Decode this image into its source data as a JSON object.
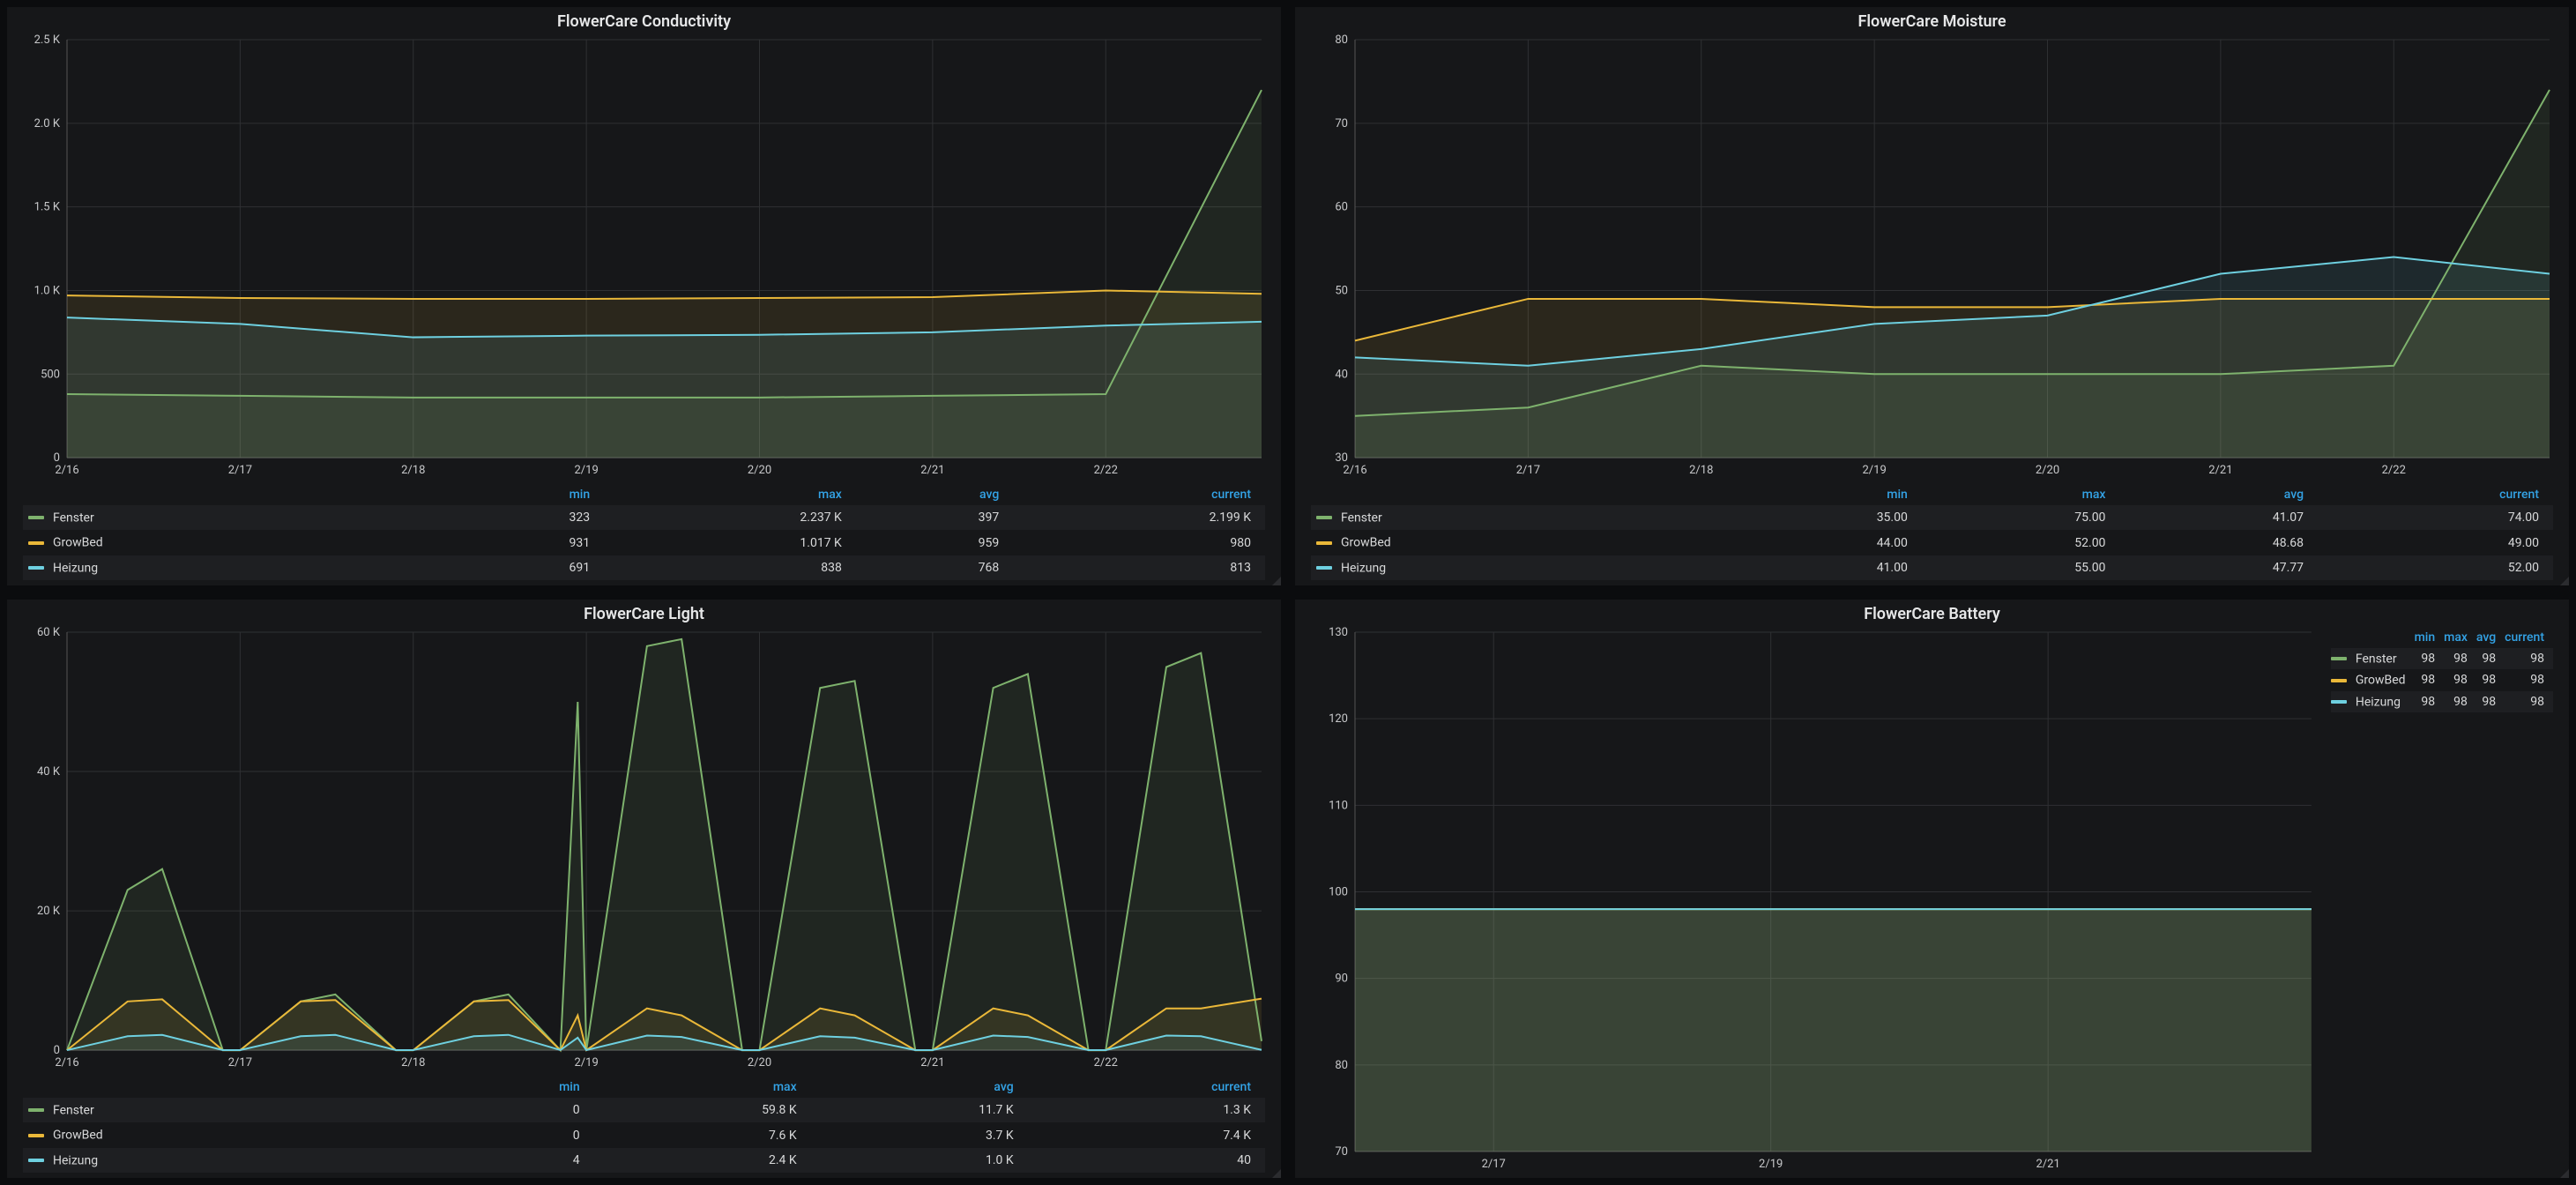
{
  "colors": {
    "Fenster": "#7eb26d",
    "GrowBed": "#eab839",
    "Heizung": "#6ed0e0"
  },
  "legend_headers": [
    "min",
    "max",
    "avg",
    "current"
  ],
  "x_ticks": {
    "seven": [
      "2/16",
      "2/17",
      "2/18",
      "2/19",
      "2/20",
      "2/21",
      "2/22"
    ],
    "three": [
      "2/17",
      "2/19",
      "2/21"
    ]
  },
  "panels": {
    "conductivity": {
      "title": "FlowerCare Conductivity",
      "y_ticks": [
        0,
        500,
        1000,
        1500,
        2000,
        2500
      ],
      "y_tick_labels": [
        "0",
        "500",
        "1.0 K",
        "1.5 K",
        "2.0 K",
        "2.5 K"
      ],
      "legend": [
        {
          "name": "Fenster",
          "min": "323",
          "max": "2.237 K",
          "avg": "397",
          "current": "2.199 K"
        },
        {
          "name": "GrowBed",
          "min": "931",
          "max": "1.017 K",
          "avg": "959",
          "current": "980"
        },
        {
          "name": "Heizung",
          "min": "691",
          "max": "838",
          "avg": "768",
          "current": "813"
        }
      ]
    },
    "moisture": {
      "title": "FlowerCare Moisture",
      "y_ticks": [
        30,
        40,
        50,
        60,
        70,
        80
      ],
      "y_tick_labels": [
        "30",
        "40",
        "50",
        "60",
        "70",
        "80"
      ],
      "legend": [
        {
          "name": "Fenster",
          "min": "35.00",
          "max": "75.00",
          "avg": "41.07",
          "current": "74.00"
        },
        {
          "name": "GrowBed",
          "min": "44.00",
          "max": "52.00",
          "avg": "48.68",
          "current": "49.00"
        },
        {
          "name": "Heizung",
          "min": "41.00",
          "max": "55.00",
          "avg": "47.77",
          "current": "52.00"
        }
      ]
    },
    "light": {
      "title": "FlowerCare Light",
      "y_ticks": [
        0,
        20000,
        40000,
        60000
      ],
      "y_tick_labels": [
        "0",
        "20 K",
        "40 K",
        "60 K"
      ],
      "legend": [
        {
          "name": "Fenster",
          "min": "0",
          "max": "59.8 K",
          "avg": "11.7 K",
          "current": "1.3 K"
        },
        {
          "name": "GrowBed",
          "min": "0",
          "max": "7.6 K",
          "avg": "3.7 K",
          "current": "7.4 K"
        },
        {
          "name": "Heizung",
          "min": "4",
          "max": "2.4 K",
          "avg": "1.0 K",
          "current": "40"
        }
      ]
    },
    "battery": {
      "title": "FlowerCare Battery",
      "y_ticks": [
        70,
        80,
        90,
        100,
        110,
        120,
        130
      ],
      "y_tick_labels": [
        "70",
        "80",
        "90",
        "100",
        "110",
        "120",
        "130"
      ],
      "legend": [
        {
          "name": "Fenster",
          "min": "98",
          "max": "98",
          "avg": "98",
          "current": "98"
        },
        {
          "name": "GrowBed",
          "min": "98",
          "max": "98",
          "avg": "98",
          "current": "98"
        },
        {
          "name": "Heizung",
          "min": "98",
          "max": "98",
          "avg": "98",
          "current": "98"
        }
      ]
    }
  },
  "chart_data": [
    {
      "id": "conductivity",
      "type": "line",
      "title": "FlowerCare Conductivity",
      "x": [
        0,
        1,
        2,
        3,
        4,
        5,
        6,
        6.9
      ],
      "xlim": [
        0,
        6.9
      ],
      "ylim": [
        0,
        2500
      ],
      "xlabel": "",
      "ylabel": "",
      "series": [
        {
          "name": "Fenster",
          "values": [
            380,
            370,
            360,
            360,
            360,
            370,
            380,
            2199
          ]
        },
        {
          "name": "GrowBed",
          "values": [
            970,
            955,
            950,
            950,
            955,
            960,
            1000,
            980
          ]
        },
        {
          "name": "Heizung",
          "values": [
            838,
            800,
            720,
            730,
            735,
            750,
            790,
            813
          ]
        }
      ]
    },
    {
      "id": "moisture",
      "type": "line",
      "title": "FlowerCare Moisture",
      "x": [
        0,
        1,
        2,
        3,
        4,
        5,
        6,
        6.9
      ],
      "xlim": [
        0,
        6.9
      ],
      "ylim": [
        30,
        80
      ],
      "xlabel": "",
      "ylabel": "",
      "series": [
        {
          "name": "Fenster",
          "values": [
            35,
            36,
            41,
            40,
            40,
            40,
            41,
            74
          ]
        },
        {
          "name": "GrowBed",
          "values": [
            44,
            49,
            49,
            48,
            48,
            49,
            49,
            49
          ]
        },
        {
          "name": "Heizung",
          "values": [
            42,
            41,
            43,
            46,
            47,
            52,
            54,
            52
          ]
        }
      ]
    },
    {
      "id": "light",
      "type": "line",
      "title": "FlowerCare Light",
      "x": [
        0,
        0.35,
        0.55,
        0.9,
        1,
        1.35,
        1.55,
        1.9,
        2,
        2.35,
        2.55,
        2.85,
        2.95,
        3,
        3.35,
        3.55,
        3.9,
        4,
        4.35,
        4.55,
        4.9,
        5,
        5.35,
        5.55,
        5.9,
        6,
        6.35,
        6.55,
        6.9
      ],
      "xlim": [
        0,
        6.9
      ],
      "ylim": [
        0,
        60000
      ],
      "xlabel": "",
      "ylabel": "",
      "series": [
        {
          "name": "Fenster",
          "values": [
            0,
            23000,
            26000,
            0,
            0,
            7000,
            8000,
            0,
            0,
            7000,
            8000,
            0,
            50000,
            0,
            58000,
            59000,
            0,
            0,
            52000,
            53000,
            0,
            0,
            52000,
            54000,
            0,
            0,
            55000,
            57000,
            1300
          ]
        },
        {
          "name": "GrowBed",
          "values": [
            0,
            7000,
            7300,
            0,
            0,
            7000,
            7200,
            0,
            0,
            7000,
            7200,
            0,
            5000,
            0,
            6000,
            5000,
            0,
            0,
            6000,
            5000,
            0,
            0,
            6000,
            5000,
            0,
            0,
            6000,
            6000,
            7400
          ]
        },
        {
          "name": "Heizung",
          "values": [
            4,
            2000,
            2200,
            20,
            20,
            2000,
            2200,
            20,
            20,
            2000,
            2200,
            20,
            1800,
            20,
            2100,
            1900,
            20,
            20,
            2000,
            1800,
            20,
            20,
            2100,
            1900,
            20,
            20,
            2100,
            2000,
            40
          ]
        }
      ]
    },
    {
      "id": "battery",
      "type": "line",
      "title": "FlowerCare Battery",
      "x": [
        0,
        1,
        2,
        3,
        4,
        5,
        6,
        6.9
      ],
      "xlim": [
        0,
        6.9
      ],
      "ylim": [
        70,
        130
      ],
      "xlabel": "",
      "ylabel": "",
      "series": [
        {
          "name": "Fenster",
          "values": [
            98,
            98,
            98,
            98,
            98,
            98,
            98,
            98
          ]
        },
        {
          "name": "GrowBed",
          "values": [
            98,
            98,
            98,
            98,
            98,
            98,
            98,
            98
          ]
        },
        {
          "name": "Heizung",
          "values": [
            98,
            98,
            98,
            98,
            98,
            98,
            98,
            98
          ]
        }
      ]
    }
  ]
}
